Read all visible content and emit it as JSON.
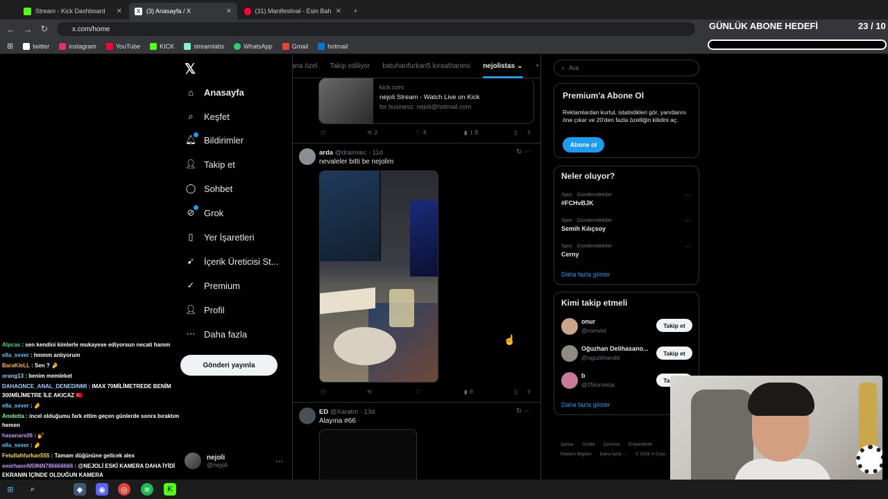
{
  "browser": {
    "tabs": [
      {
        "title": "Stream - Kick Dashboard",
        "icon": "kick-icon",
        "color": "#53fc18"
      },
      {
        "title": "(3) Anasayfa / X",
        "icon": "x-icon",
        "color": "#ffffff"
      },
      {
        "title": "(31) Manifestival - Esin Bahat İn",
        "icon": "youtube-icon",
        "color": "#ff0033"
      }
    ],
    "url": "x.com/home",
    "bookmarks": [
      {
        "label": "twitter",
        "icon": "x-icon",
        "color": "#ffffff"
      },
      {
        "label": "instagram",
        "icon": "instagram-icon",
        "color": "#e1306c"
      },
      {
        "label": "YouTube",
        "icon": "youtube-icon",
        "color": "#ff0033"
      },
      {
        "label": "KICK",
        "icon": "kick-icon",
        "color": "#53fc18"
      },
      {
        "label": "streamlabs",
        "icon": "streamlabs-icon",
        "color": "#80f5d2"
      },
      {
        "label": "WhatsApp",
        "icon": "whatsapp-icon",
        "color": "#25d366"
      },
      {
        "label": "Gmail",
        "icon": "gmail-icon",
        "color": "#ea4335"
      },
      {
        "label": "hotmail",
        "icon": "outlook-icon",
        "color": "#0078d4"
      }
    ]
  },
  "overlay": {
    "goal_title": "GÜNLÜK ABONE HEDEFİ",
    "goal_count": "23 / 10"
  },
  "sidebar": {
    "items": [
      {
        "label": "Anasayfa",
        "icon": "home-icon"
      },
      {
        "label": "Keşfet",
        "icon": "search-icon"
      },
      {
        "label": "Bildirimler",
        "icon": "bell-icon"
      },
      {
        "label": "Takip et",
        "icon": "person-add-icon"
      },
      {
        "label": "Sohbet",
        "icon": "chat-icon"
      },
      {
        "label": "Grok",
        "icon": "grok-icon"
      },
      {
        "label": "Yer İşaretleri",
        "icon": "bookmark-icon"
      },
      {
        "label": "İçerik Üreticisi St...",
        "icon": "rocket-icon"
      },
      {
        "label": "Premium",
        "icon": "verified-icon"
      },
      {
        "label": "Profil",
        "icon": "profile-icon"
      },
      {
        "label": "Daha fazla",
        "icon": "more-circle-icon"
      }
    ],
    "post_button": "Gönderi yayınla",
    "user": {
      "name": "nejoli",
      "handle": "@nejoli"
    }
  },
  "timeline": {
    "tabs": [
      "Sana özel",
      "Takip ediliyor",
      "batuhanfurkan5 kıraathanesi",
      "nejolistas",
      "+"
    ],
    "active_tab": "nejolistas",
    "link_card": {
      "domain": "kick.com",
      "title": "nejoli Stream - Watch Live on Kick",
      "subtitle": "for business: nejoli@hotmail.com"
    },
    "card_stats": {
      "retweets": "2",
      "likes": "8",
      "views": "1 B"
    },
    "tweets": [
      {
        "name": "arda",
        "handle": "@drainsec",
        "time": "11d",
        "text": "nevaleler bitti be nejolim",
        "views": "6"
      },
      {
        "name": "ED",
        "handle": "@Xaratm",
        "time": "13d",
        "text": "Alayına #66"
      }
    ]
  },
  "right": {
    "search_placeholder": "Ara",
    "premium": {
      "title": "Premium'a Abone Ol",
      "text": "Reklamlardan kurtul, istatistikleri gör, yanıtlarını öne çıkar ve 20'den fazla özelliğin kilidini aç.",
      "button": "Abone ol"
    },
    "trends": {
      "title": "Neler oluyor?",
      "items": [
        {
          "category": "Spor · Gündemdekiler",
          "name": "#FCHvBJK"
        },
        {
          "category": "Spor · Gündemdekiler",
          "name": "Semih Kılıçsoy"
        },
        {
          "category": "Spor · Gündemdekiler",
          "name": "Cerny"
        }
      ],
      "more": "Daha fazla göster"
    },
    "who_to_follow": {
      "title": "Kimi takip etmeli",
      "items": [
        {
          "name": "onur",
          "handle": "@romvisl",
          "button": "Takip et"
        },
        {
          "name": "Oğuzhan Delihasano...",
          "handle": "@oguzkhandd",
          "button": "Takip et"
        },
        {
          "name": "b",
          "handle": "@25roronoa",
          "button": "Takip et"
        }
      ],
      "more": "Daha fazla göster"
    },
    "footer": [
      "Şartlar",
      "Gizlilik",
      "Çerezler",
      "Erişilebilirlik",
      "Reklam Bilgileri",
      "Daha fazla ···",
      "© 2026 X Corp."
    ]
  },
  "chat": [
    {
      "user": "Alpcas",
      "color": "#3ddc84",
      "text": ": sen kendini kimlerle mukayese ediyorsun necati hanım"
    },
    {
      "user": "ella_sever",
      "color": "#60c8ff",
      "text": ": hmmm anlıyorum"
    },
    {
      "user": "BaraKleLL",
      "color": "#ffb347",
      "text": ": Sen ? 🤌"
    },
    {
      "user": "orang13",
      "color": "#9ad0ff",
      "text": ": benim memleket"
    },
    {
      "user": "DAHAONCE_ANAL_DENEDINMI",
      "color": "#9ad0ff",
      "text": ": IMAX 70MİLİMETREDE BENİM 300MİLİMETRE İLE AKICAZ 🇹🇷"
    },
    {
      "user": "ella_sever",
      "color": "#60c8ff",
      "text": ": 🤌"
    },
    {
      "user": "Amdetta",
      "color": "#7dff9a",
      "text": ": incel olduğumu fark ettim geçen günlerde sonra bıraktım hemen"
    },
    {
      "user": "hasanars06",
      "color": "#c89bff",
      "text": ": 💅"
    },
    {
      "user": "ella_sever",
      "color": "#60c8ff",
      "text": ": 🤌"
    },
    {
      "user": "Fetullahfurkan555",
      "color": "#ffd84a",
      "text": ": Tamam düğününe gelicek alex"
    },
    {
      "user": "emirhannN59NN786666666",
      "color": "#c89bff",
      "text": ": @NEJOLİ ESKİ KAMERA DAHA İYİDİ EKRANIN İÇİNDE OLDUĞUN KAMERA"
    }
  ]
}
